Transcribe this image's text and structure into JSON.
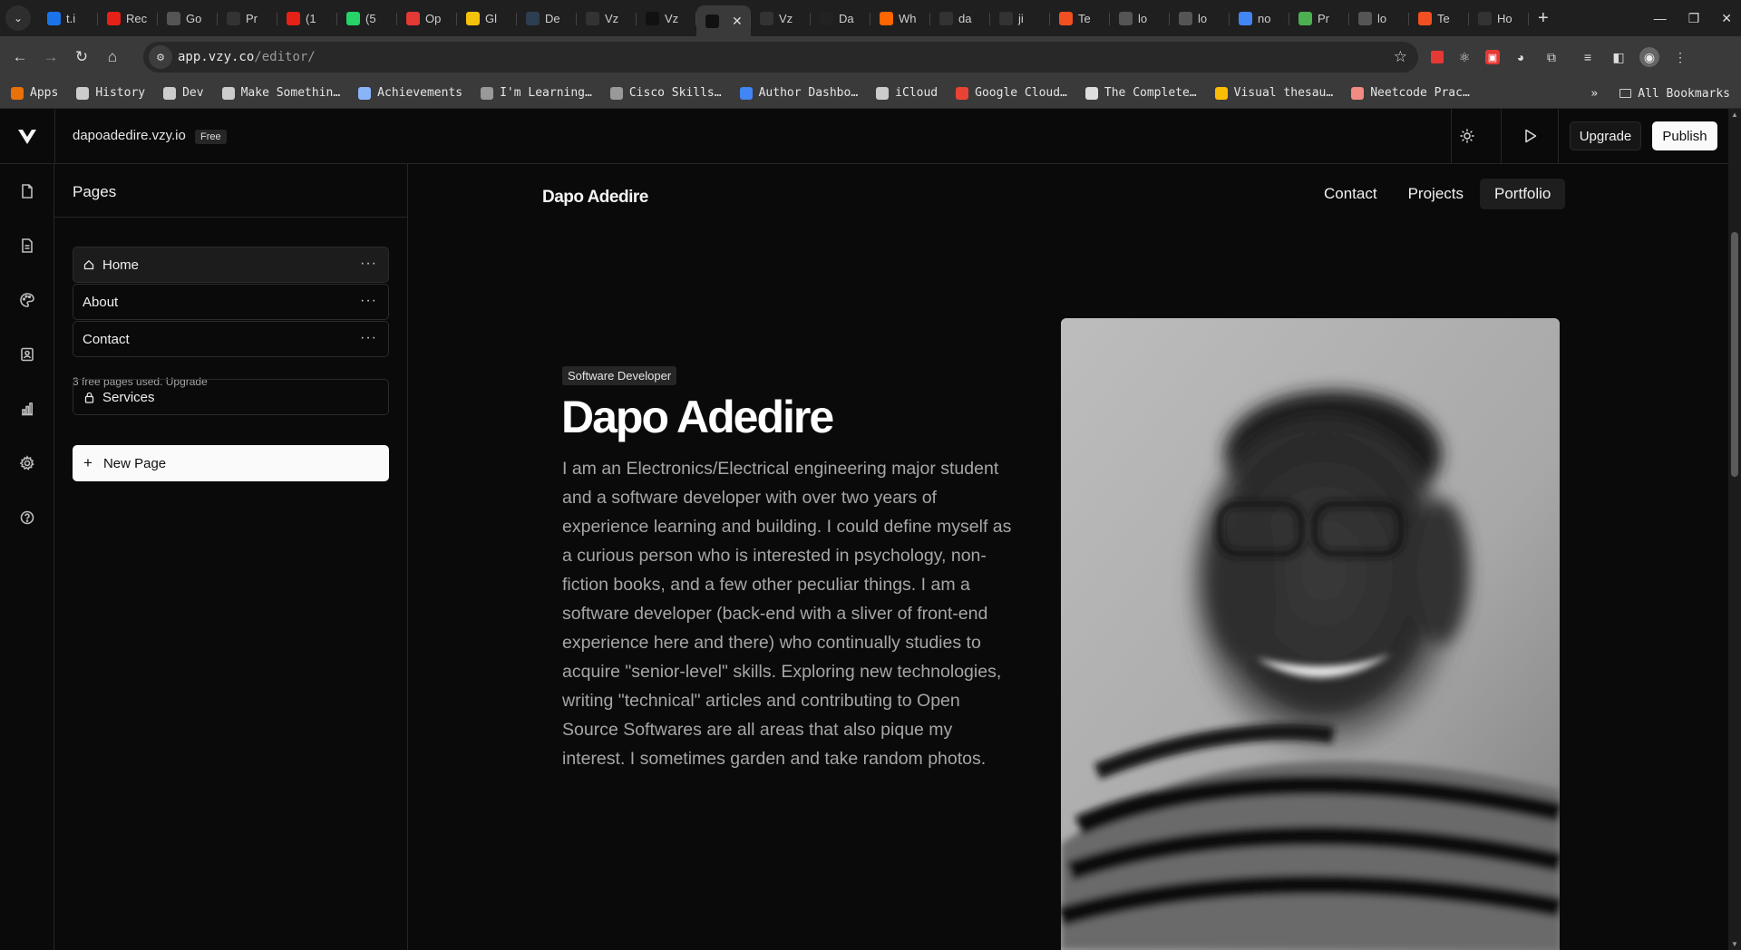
{
  "browser": {
    "tabs": [
      {
        "label": "t.i",
        "color": "#1a73e8"
      },
      {
        "label": "Rec",
        "color": "#e62117"
      },
      {
        "label": "Go",
        "color": "#555555"
      },
      {
        "label": "Pr",
        "color": "#333333"
      },
      {
        "label": "(1",
        "color": "#e62117"
      },
      {
        "label": "(5",
        "color": "#25d366"
      },
      {
        "label": "Op",
        "color": "#e53935"
      },
      {
        "label": "Gl",
        "color": "#f4c20d"
      },
      {
        "label": "De",
        "color": "#2d3e50"
      },
      {
        "label": "Vz",
        "color": "#333333"
      },
      {
        "label": "Vz",
        "color": "#111111"
      },
      {
        "label": "",
        "color": "#111111"
      },
      {
        "label": "Vz",
        "color": "#333333"
      },
      {
        "label": "Da",
        "color": "#222222"
      },
      {
        "label": "Wh",
        "color": "#ff6600"
      },
      {
        "label": "da",
        "color": "#333333"
      },
      {
        "label": "ji",
        "color": "#333333"
      },
      {
        "label": "Te",
        "color": "#f25022"
      },
      {
        "label": "lo",
        "color": "#555555"
      },
      {
        "label": "lo",
        "color": "#555555"
      },
      {
        "label": "no",
        "color": "#4285f4"
      },
      {
        "label": "Pr",
        "color": "#4caf50"
      },
      {
        "label": "lo",
        "color": "#555555"
      },
      {
        "label": "Te",
        "color": "#f25022"
      },
      {
        "label": "Ho",
        "color": "#333333"
      }
    ],
    "active_tab_index": 11,
    "url_host": "app.vzy.co",
    "url_path": "/editor/",
    "bookmarks": [
      {
        "label": "Apps",
        "icon": "apps-grid-icon",
        "color": "#e8710a"
      },
      {
        "label": "History",
        "icon": "history-icon",
        "color": "#cccccc"
      },
      {
        "label": "Dev",
        "icon": "folder-icon",
        "color": "#cccccc"
      },
      {
        "label": "Make Somethin…",
        "icon": "bulb-icon",
        "color": "#cccccc"
      },
      {
        "label": "Achievements",
        "icon": "medal-icon",
        "color": "#8ab4f8"
      },
      {
        "label": "I'm Learning…",
        "icon": "book-icon",
        "color": "#999999"
      },
      {
        "label": "Cisco Skills…",
        "icon": "cisco-icon",
        "color": "#999999"
      },
      {
        "label": "Author Dashbo…",
        "icon": "author-icon",
        "color": "#4285f4"
      },
      {
        "label": "iCloud",
        "icon": "apple-icon",
        "color": "#cccccc"
      },
      {
        "label": "Google Cloud…",
        "icon": "cloud-icon",
        "color": "#ea4335"
      },
      {
        "label": "The Complete…",
        "icon": "flame-icon",
        "color": "#dddddd"
      },
      {
        "label": "Visual thesau…",
        "icon": "thesaurus-icon",
        "color": "#fbbc04"
      },
      {
        "label": "Neetcode Prac…",
        "icon": "rocket-icon",
        "color": "#f28b82"
      }
    ],
    "all_bookmarks_label": "All Bookmarks"
  },
  "app": {
    "site_domain": "dapoadedire.vzy.io",
    "plan_badge": "Free",
    "upgrade_label": "Upgrade",
    "publish_label": "Publish"
  },
  "pages_panel": {
    "title": "Pages",
    "pages": [
      {
        "label": "Home",
        "selected": true,
        "home": true
      },
      {
        "label": "About",
        "selected": false,
        "home": false
      },
      {
        "label": "Contact",
        "selected": false,
        "home": false
      }
    ],
    "limit_text": "3 free pages used. Upgrade",
    "locked_page": "Services",
    "new_page_label": "New Page"
  },
  "site": {
    "brand": "Dapo Adedire",
    "nav": [
      "Contact",
      "Projects",
      "Portfolio"
    ],
    "active_nav": "Portfolio",
    "role_badge": "Software Developer",
    "hero_name": "Dapo Adedire",
    "bio": "I am an Electronics/Electrical engineering major student and a software developer with over two years of experience learning and building. I could define myself as a curious person who is interested in psychology, non-fiction books, and a few other peculiar things. I am a software developer (back-end with a sliver of front-end experience here and there) who continually studies to acquire \"senior-level\" skills. Exploring new technologies, writing \"technical\" articles and contributing to Open Source Softwares are all areas that also pique my interest. I sometimes garden and take random photos."
  },
  "colors": {
    "app_bg": "#0a0a0a",
    "border": "#262626",
    "primary_button_bg": "#fafafa",
    "body_text_muted": "#a6a6a6"
  }
}
